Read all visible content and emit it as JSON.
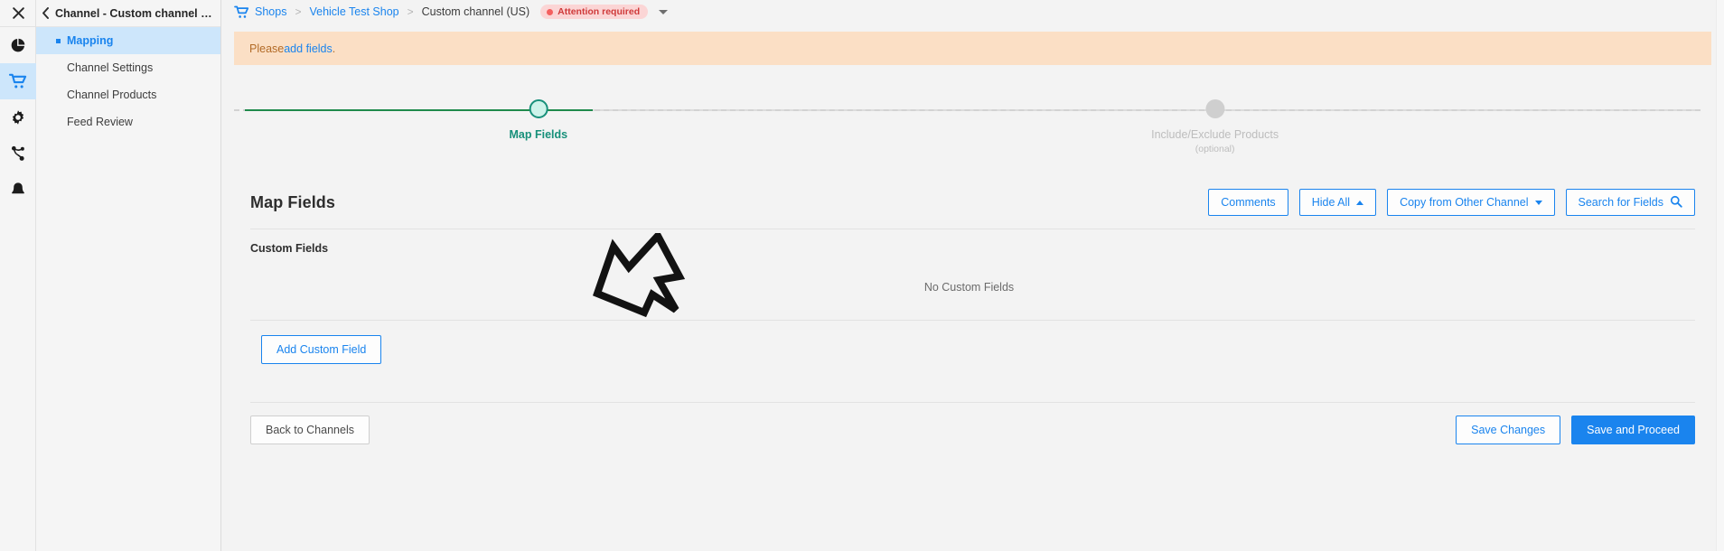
{
  "rail": {
    "items": [
      {
        "name": "close-icon",
        "label": "Close"
      },
      {
        "name": "analytics-icon",
        "label": "Analytics"
      },
      {
        "name": "shops-cart-icon",
        "label": "Shops"
      },
      {
        "name": "settings-gear-icon",
        "label": "Settings"
      },
      {
        "name": "integrations-icon",
        "label": "Integrations"
      },
      {
        "name": "notifications-bell-icon",
        "label": "Notifications"
      }
    ]
  },
  "sidebar": {
    "back_label": "Channel - Custom channel (US)",
    "items": [
      {
        "label": "Mapping",
        "selected": true
      },
      {
        "label": "Channel Settings",
        "selected": false
      },
      {
        "label": "Channel Products",
        "selected": false
      },
      {
        "label": "Feed Review",
        "selected": false
      }
    ]
  },
  "breadcrumb": {
    "shops": "Shops",
    "shop": "Vehicle Test Shop",
    "current": "Custom channel (US)",
    "separator": ">",
    "status_badge": "Attention required",
    "status_color": "#cf3a3a",
    "status_bg": "#fbd5d5"
  },
  "alert": {
    "prefix": "Please ",
    "link": "add fields",
    "suffix": "."
  },
  "stepper": {
    "steps": [
      {
        "label": "Map Fields",
        "sub": "",
        "state": "current"
      },
      {
        "label": "Include/Exclude Products",
        "sub": "(optional)",
        "state": "pending"
      }
    ],
    "done_color": "#1f8a4c",
    "current_color": "#17907a"
  },
  "card": {
    "title": "Map Fields",
    "tools": {
      "comments": "Comments",
      "hide_all": "Hide All",
      "copy_from_other_channel": "Copy from Other Channel",
      "search_for_fields": "Search for Fields"
    },
    "custom_fields_label": "Custom Fields",
    "empty_text": "No Custom Fields",
    "add_custom_field": "Add Custom Field"
  },
  "footer": {
    "back_to_channels": "Back to Channels",
    "save_changes": "Save Changes",
    "save_and_proceed": "Save and Proceed"
  },
  "annotation": {
    "arrow": "hand-drawn-arrow pointing down-left at Add Custom Field"
  },
  "theme": {
    "accent": "#1a84ee",
    "warning_bg": "#fbdfc5",
    "warning_text": "#b36b27"
  }
}
